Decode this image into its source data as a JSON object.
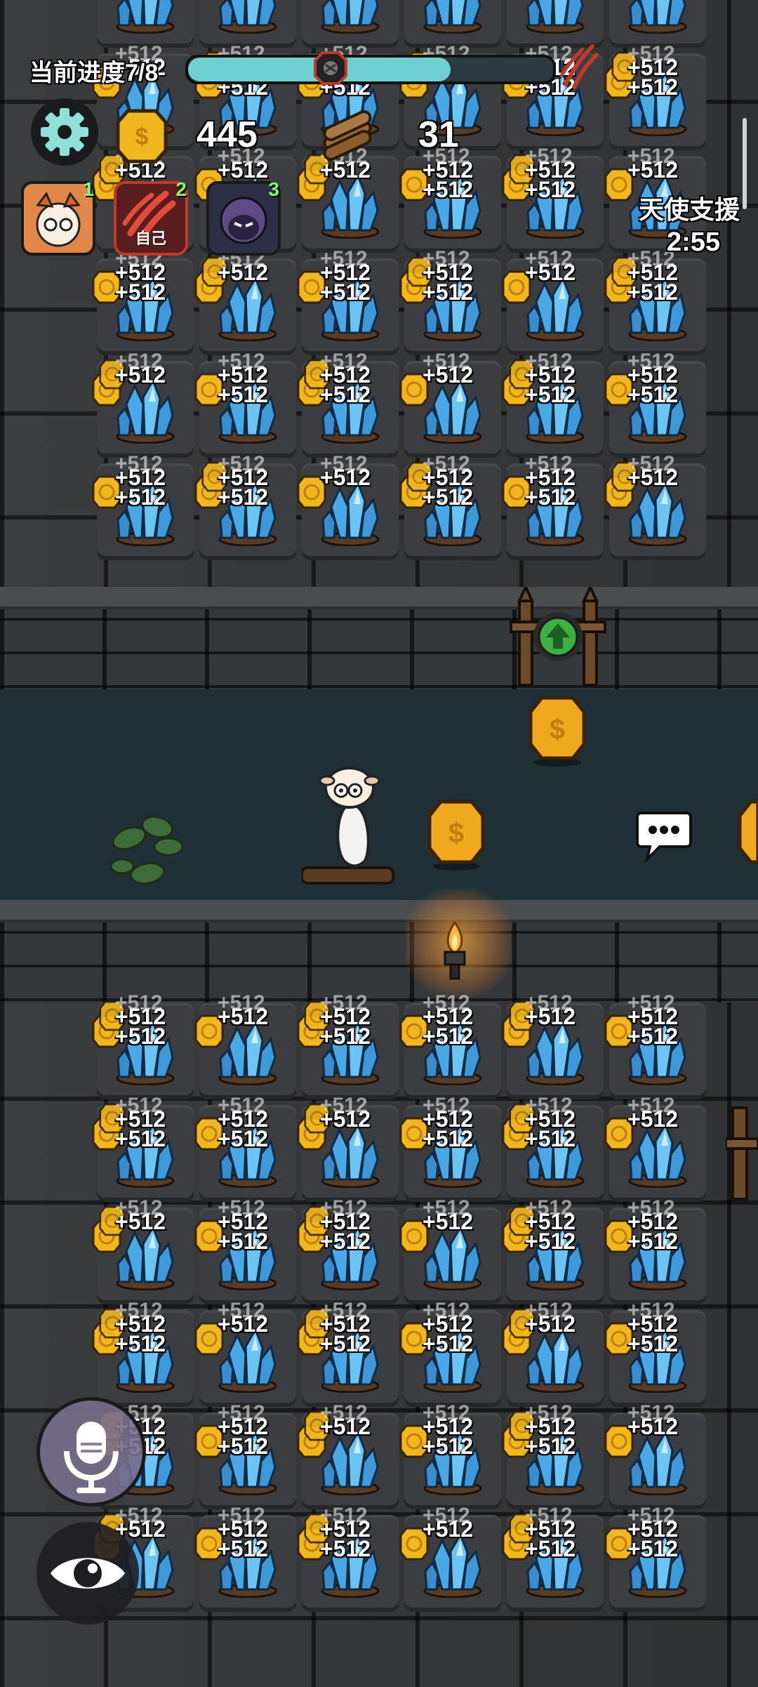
{
  "hud": {
    "progress_label": "当前进度7/8",
    "progress_fraction": 0.72,
    "gold_amount": "445",
    "wood_amount": "31"
  },
  "players": [
    {
      "rank": "1",
      "tag": ""
    },
    {
      "rank": "2",
      "tag": "自己"
    },
    {
      "rank": "3",
      "tag": ""
    }
  ],
  "angel_support": {
    "label": "天使支援",
    "timer": "2:55"
  },
  "tiles": {
    "reward_text": "+512"
  },
  "icons": {
    "settings": "gear-icon",
    "gold": "gold-coin-icon",
    "wood": "wood-logs-icon",
    "boss": "boss-icon",
    "claw": "claw-mark-icon",
    "chat": "chat-bubble-icon",
    "voice": "microphone-icon",
    "view": "eye-icon",
    "upgrade": "upgrade-arrow-icon"
  },
  "colors": {
    "progress_fill": "#6fd0d2",
    "progress_bg": "#2d3a40",
    "crystal": "#5bb7ec",
    "coin": "#f0b81e",
    "upgrade_green": "#3cb043",
    "rank_green": "#7CFC6A",
    "self_red": "#c0392b"
  }
}
